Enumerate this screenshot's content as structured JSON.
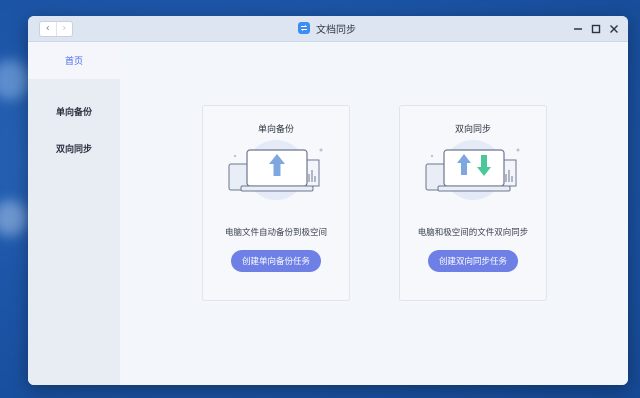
{
  "window": {
    "title": "文档同步",
    "nav_back": "‹",
    "nav_forward": "›"
  },
  "sidebar": {
    "items": [
      {
        "label": "首页",
        "active": true
      },
      {
        "label": "单向备份",
        "active": false
      },
      {
        "label": "双向同步",
        "active": false
      }
    ]
  },
  "cards": [
    {
      "title": "单向备份",
      "description": "电脑文件自动备份到极空间",
      "button": "创建单向备份任务",
      "icon": "upload-arrow-icon"
    },
    {
      "title": "双向同步",
      "description": "电脑和极空间的文件双向同步",
      "button": "创建双向同步任务",
      "icon": "sync-arrows-icon"
    }
  ],
  "colors": {
    "accent": "#6e7fe6",
    "active_nav": "#4a6ae8",
    "upload_arrow": "#7ea7df",
    "download_arrow": "#4cc79a"
  }
}
